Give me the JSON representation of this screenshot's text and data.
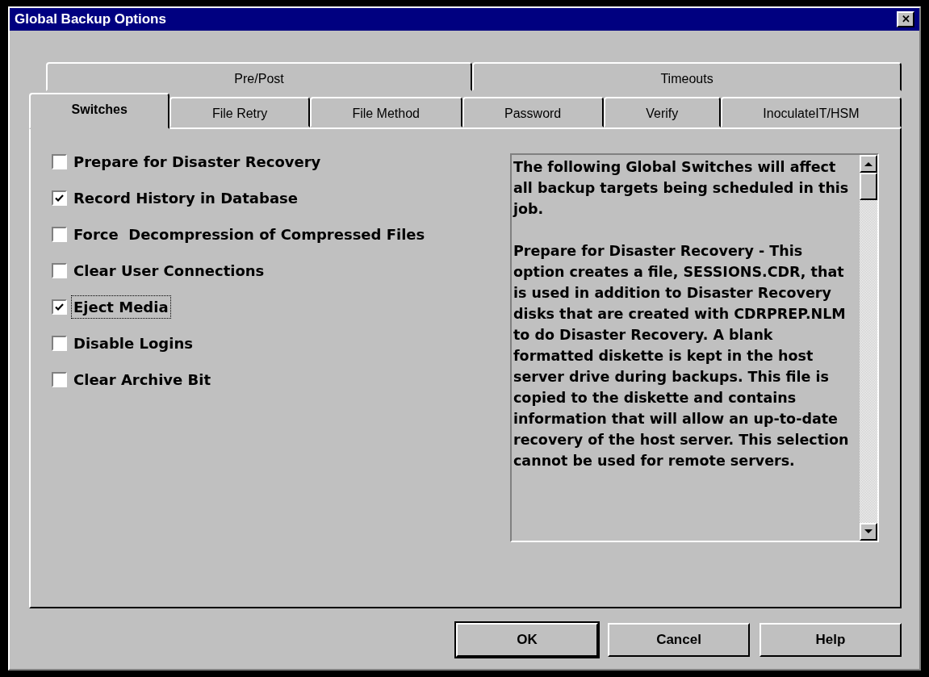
{
  "window": {
    "title": "Global Backup Options",
    "close": "✕"
  },
  "tab_rows": [
    [
      {
        "label": "Pre/Post",
        "selected": false
      },
      {
        "label": "Timeouts",
        "selected": false
      }
    ],
    [
      {
        "label": "Switches",
        "selected": true
      },
      {
        "label": "File Retry",
        "selected": false
      },
      {
        "label": "File Method",
        "selected": false
      },
      {
        "label": "Password",
        "selected": false
      },
      {
        "label": "Verify",
        "selected": false
      },
      {
        "label": "InoculateIT/HSM",
        "selected": false
      }
    ]
  ],
  "options": [
    {
      "label": "Prepare for Disaster Recovery",
      "checked": false,
      "focused": false
    },
    {
      "label": "Record History in Database",
      "checked": true,
      "focused": false
    },
    {
      "label": "Force  Decompression of Compressed Files",
      "checked": false,
      "focused": false
    },
    {
      "label": "Clear User Connections",
      "checked": false,
      "focused": false
    },
    {
      "label": "Eject Media",
      "checked": true,
      "focused": true
    },
    {
      "label": "Disable Logins",
      "checked": false,
      "focused": false
    },
    {
      "label": "Clear Archive Bit",
      "checked": false,
      "focused": false
    }
  ],
  "description": [
    "The following Global Switches will affect all backup targets being scheduled in this job.",
    "Prepare for Disaster Recovery - This option creates a file, SESSIONS.CDR, that is used in addition to Disaster Recovery disks that are created with CDRPREP.NLM to do Disaster Recovery. A blank formatted diskette is kept in the host server drive during backups. This file is copied to the diskette and contains information that will allow an up-to-date recovery of the host server. This selection cannot be used for remote servers."
  ],
  "buttons": [
    {
      "label": "OK",
      "default": true
    },
    {
      "label": "Cancel",
      "default": false
    },
    {
      "label": "Help",
      "default": false
    }
  ]
}
